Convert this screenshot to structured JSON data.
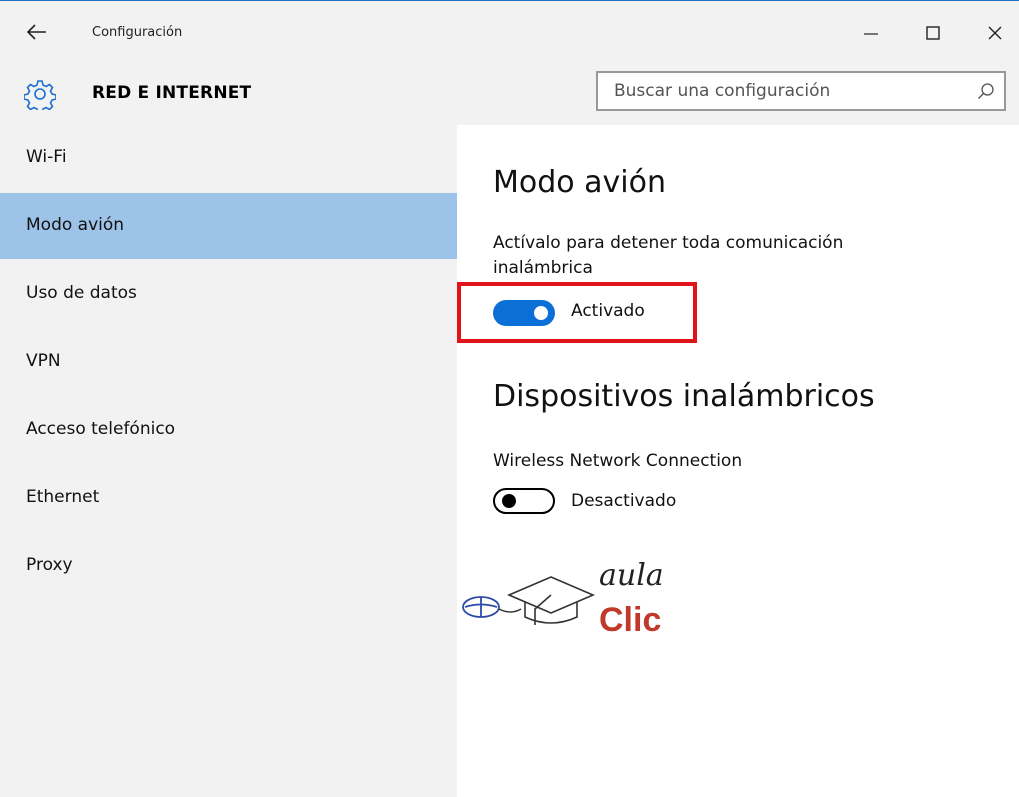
{
  "window": {
    "title": "Configuración",
    "controls": {
      "minimize": "—",
      "maximize": "☐",
      "close": "✕"
    }
  },
  "header": {
    "icon": "gear-icon",
    "section_title": "RED E INTERNET",
    "search": {
      "placeholder": "Buscar una configuración",
      "value": "",
      "icon": "search-icon"
    }
  },
  "sidebar": {
    "items": [
      {
        "label": "Wi-Fi",
        "selected": false
      },
      {
        "label": "Modo avión",
        "selected": true
      },
      {
        "label": "Uso de datos",
        "selected": false
      },
      {
        "label": "VPN",
        "selected": false
      },
      {
        "label": "Acceso telefónico",
        "selected": false
      },
      {
        "label": "Ethernet",
        "selected": false
      },
      {
        "label": "Proxy",
        "selected": false
      }
    ]
  },
  "main": {
    "airplane": {
      "heading": "Modo avión",
      "description": "Actívalo para detener toda comunicación inalámbrica",
      "toggle_state": true,
      "toggle_label": "Activado"
    },
    "wireless": {
      "heading": "Dispositivos inalámbricos",
      "device_name": "Wireless Network Connection",
      "toggle_state": false,
      "toggle_label": "Desactivado"
    }
  },
  "watermark": {
    "line1": "aula",
    "line2": "Clic"
  },
  "colors": {
    "accent": "#0a6fd6",
    "selected_nav": "#9dc3e8",
    "panel_bg": "#f2f2f2",
    "highlight": "#e0131b",
    "logo_red": "#c0392b",
    "logo_blue": "#2d4aa8"
  }
}
